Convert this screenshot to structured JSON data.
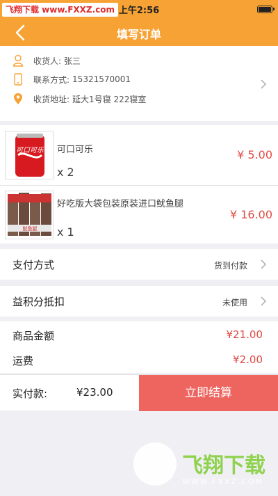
{
  "watermark": {
    "top_badge": "飞翔下载 www.FXXZ.com",
    "logo_text": "飞翔下载",
    "logo_url": "WWW.FXXZ.COM"
  },
  "status_bar": {
    "time": "上午2:56"
  },
  "nav": {
    "title": "填写订单",
    "back_icon": "chevron-left-icon"
  },
  "address": {
    "receiver_label": "收货人:",
    "receiver": "张三",
    "phone_label": "联系方式:",
    "phone": "15321570001",
    "address_label": "收货地址:",
    "address": "延大1号寝 222寝室"
  },
  "products": [
    {
      "name": "可口可乐",
      "qty": "x 2",
      "price": "¥ 5.00"
    },
    {
      "name": "好吃版大袋包装原装进口鱿鱼腿",
      "qty": "x 1",
      "price": "¥ 16.00"
    }
  ],
  "payment": {
    "label": "支付方式",
    "value": "货到付款"
  },
  "points": {
    "label": "益积分抵扣",
    "value": "未使用"
  },
  "summary": {
    "goods_label": "商品金额",
    "goods_value": "¥21.00",
    "shipping_label": "运费",
    "shipping_value": "¥2.00"
  },
  "bottom": {
    "pay_label": "实付款:",
    "pay_total": "¥23.00",
    "checkout_label": "立即结算"
  },
  "colors": {
    "brand": "#f7a234",
    "price": "#e04b45",
    "checkout": "#ee6560"
  }
}
